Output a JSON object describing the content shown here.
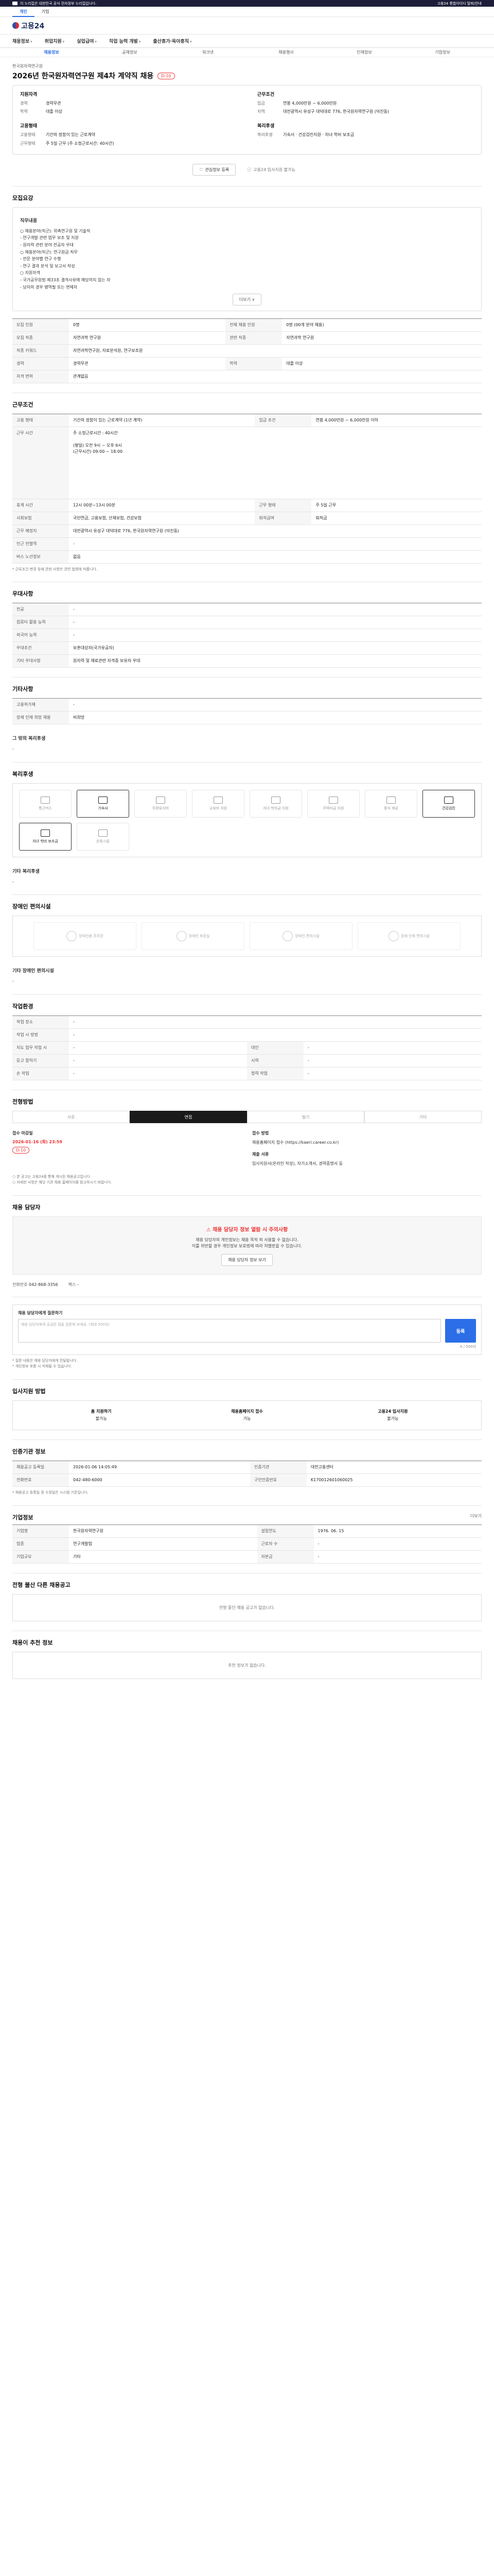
{
  "topbar": {
    "left_text": "이 누리집은 대한민국 공식 전자정부 누리집입니다.",
    "right_text": "고용24 통합아이디 탈퇴/안내"
  },
  "gtabs": [
    "개인",
    "기업"
  ],
  "logo": {
    "text": "고용24"
  },
  "gnb": [
    "채용정보",
    "취업지원",
    "실업급여",
    "직업 능력 개발",
    "출산휴가·육아휴직"
  ],
  "subnav": [
    "채용정보",
    "공채정보",
    "워크넷",
    "채용행사",
    "인재정보",
    "기업정보"
  ],
  "job": {
    "company": "한국원자력연구원",
    "title": "2026년 한국원자력연구원 제4차 계약직 채용",
    "dday": "D-10"
  },
  "summary": {
    "left_title": "지원자격",
    "left_rows": [
      {
        "k": "경력",
        "v": "경력무관"
      },
      {
        "k": "학력",
        "v": "대졸 이상"
      }
    ],
    "right_title": "근무조건",
    "right_rows": [
      {
        "k": "임금",
        "v": "연봉 4,000만원 ~ 6,000만원"
      },
      {
        "k": "지역",
        "v": "대전광역시 유성구 대덕대로 776, 한국원자력연구원 (덕진동)"
      }
    ],
    "left_title2": "고용형태",
    "left_rows2": [
      {
        "k": "고용형태",
        "v": "기간의 정함이 있는 근로계약"
      },
      {
        "k": "근무형태",
        "v": "주 5일 근무 (주 소정근로시간: 40시간)"
      }
    ],
    "right_title2": "복리후생",
    "right_rows2": [
      {
        "k": "복리후생",
        "v": "기숙사 · 건강검진지원 · 자녀 학비 보조금"
      }
    ]
  },
  "actions": {
    "save": "관심정보 등록",
    "report": "고용24 입사지원 불가능"
  },
  "recruit": {
    "title": "모집요강",
    "box_title": "직무내용",
    "body": "○ 채용분야(직군): 위촉연구원 및 기술직\n - 연구개발 관련 업무 보조 및 지원\n - 원자력 관련 분야 전공자 우대\n○ 채용분야(직군): 연구원급 직무\n - 전문 분야별 연구 수행\n - 연구 결과 분석 및 보고서 작성\n○ 지원자격\n - 국가공무원법 제33조 결격사유에 해당하지 않는 자\n - 남자의 경우 병역필 또는 면제자",
    "more_label": "더보기 ∨",
    "rows": [
      {
        "k": "모집 인원",
        "v": "0명",
        "k2": "전체 채용 인원",
        "v2": "0명 (00개 분야 채용)"
      },
      {
        "k": "모집 직종",
        "v": "자연과학 연구원",
        "k2": "관련 직종",
        "v2": "자연과학 연구원"
      },
      {
        "k": "직종 키워드",
        "v": "자연과학연구원, 자료분석원, 연구보조원",
        "k2": "",
        "v2": ""
      },
      {
        "k": "경력",
        "v": "경력무관",
        "k2": "학력",
        "v2": "대졸 이상"
      },
      {
        "k": "자격 면허",
        "v": "관계없음",
        "k2": "",
        "v2": ""
      }
    ]
  },
  "conditions": {
    "title": "근무조건",
    "rows": [
      {
        "k": "고용 형태",
        "v": "기간의 정함이 있는 근로계약 (1년 계약)",
        "k2": "임금 조건",
        "v2": "연봉 4,000만원 ~ 6,000만원 이하"
      },
      {
        "k": "근무 시간",
        "v": "주 소정근로시간 : 40시간\n\n(평일) 오전 9시 ~ 오후 6시\n(근무시간) 09:00 ~ 18:00",
        "k2": "",
        "v2": ""
      },
      {
        "k": "휴게 시간",
        "v": "12시 00분~13시 00분",
        "k2": "근무 형태",
        "v2": "주 5일 근무"
      },
      {
        "k": "사회보험",
        "v": "국민연금, 고용보험, 산재보험, 건강보험",
        "k2": "퇴직급여",
        "v2": "퇴직금"
      },
      {
        "k": "근무 예정지",
        "v": "대전광역시 유성구 대덕대로 776, 한국원자력연구원 (덕진동)",
        "k2": "",
        "v2": ""
      },
      {
        "k": "인근 전철역",
        "v": "-",
        "k2": "",
        "v2": ""
      },
      {
        "k": "버스 노선정보",
        "v": "없음",
        "k2": "",
        "v2": ""
      }
    ],
    "note": "* 근로조건 변경 등에 관한 사항은 관련 법령에 따릅니다."
  },
  "prefs": {
    "title": "우대사항",
    "rows": [
      {
        "k": "전공",
        "v": "-"
      },
      {
        "k": "컴퓨터 활용 능력",
        "v": "-"
      },
      {
        "k": "외국어 능력",
        "v": "-"
      },
      {
        "k": "우대조건",
        "v": "보훈대상자(국가유공자)"
      },
      {
        "k": "기타 우대사항",
        "v": "원자력 및 재료관련 자격증 보유자 우대"
      }
    ]
  },
  "etc": {
    "title": "기타사항",
    "rows": [
      {
        "k": "고용허가제",
        "v": "-"
      },
      {
        "k": "장애 인재 희망 채용",
        "v": "비희망"
      }
    ],
    "extra_label": "그 밖의 복리후생",
    "extra_value": "-"
  },
  "welfare": {
    "title": "복리후생",
    "tiles": [
      {
        "label": "통근버스",
        "on": false
      },
      {
        "label": "기숙사",
        "on": true
      },
      {
        "label": "차량유지비",
        "on": false
      },
      {
        "label": "교육비 지원",
        "on": false
      },
      {
        "label": "자녀 학자금 지원",
        "on": false
      },
      {
        "label": "주택자금 지원",
        "on": false
      },
      {
        "label": "중식 제공",
        "on": false
      },
      {
        "label": "건강검진",
        "on": true
      },
      {
        "label": "자녀 학비 보조금",
        "on": true
      },
      {
        "label": "운동시설",
        "on": false
      }
    ],
    "extra_label": "기타 복리후생",
    "extra_value": "-"
  },
  "disability": {
    "title": "장애인 편의시설",
    "items": [
      "장애인용 주차장",
      "장애인 화장실",
      "장애인 편의시설",
      "장애 인재 편의시설"
    ],
    "extra_label": "기타 장애인 편의시설",
    "extra_value": "-"
  },
  "workenv": {
    "title": "작업환경",
    "rows": [
      {
        "k": "작업 장소",
        "v": "-",
        "k2": "",
        "v2": ""
      },
      {
        "k": "작업 시 방법",
        "v": "-",
        "k2": "",
        "v2": ""
      },
      {
        "k": "지도 업무 작업 시",
        "v": "-",
        "k2": "대인",
        "v2": "-"
      },
      {
        "k": "듣고 말하기",
        "v": "-",
        "k2": "시력",
        "v2": "-"
      },
      {
        "k": "손 작업",
        "v": "-",
        "k2": "청력 작업",
        "v2": "-"
      }
    ]
  },
  "process": {
    "title": "전형방법",
    "steps": [
      "서류",
      "면접",
      "필기",
      "기타"
    ],
    "deadline_title": "접수 마감일",
    "deadline": "2026-01-16 (화) 23:59",
    "dday": "D-10",
    "method_title": "접수 방법",
    "method": "채용홈페이지 접수 (https://kaeri.career.co.kr)",
    "docs_title": "제출 서류",
    "docs": "입사지원서(온라인 작성), 자기소개서, 경력증명서 등",
    "notes": "○ 본 공고는 고용24를 통해 게시된 채용공고입니다.\n○ 자세한 사항은 해당 기관 채용 홈페이지를 참고하시기 바랍니다."
  },
  "contact": {
    "title": "채용 담당자",
    "caution_title": "채용 담당자 정보 열람 시 주의사항",
    "caution_body": "채용 담당자의 개인정보는 채용 목적 외 사용할 수 없습니다.\n이를 위반할 경우 개인정보 보호법에 따라 처벌받을 수 있습니다.",
    "caution_button": "채용 담당자 정보 보기",
    "phone_label": "전화번호",
    "phone": "042-868-3356",
    "fax_label": "팩스",
    "fax": "-"
  },
  "qa": {
    "title": "채용 담당자에게 질문하기",
    "placeholder": "채용 담당자에게 궁금한 점을 질문해 보세요. (최대 500자)",
    "count": "0 / 500자",
    "submit": "등록",
    "notes": "* 질문 내용은 채용 담당자에게 전달됩니다.\n* 개인정보 포함 시 삭제될 수 있습니다."
  },
  "apply": {
    "title": "입사지원 방법",
    "methods": [
      {
        "name": "홈 지원하기",
        "v": "불가능"
      },
      {
        "name": "채용홈페이지 접수",
        "v": "가능"
      },
      {
        "name": "고용24 입사지원",
        "v": "불가능"
      }
    ]
  },
  "info": {
    "title": "인증기관 정보",
    "rows": [
      {
        "k": "채용공고 등록일",
        "v": "2026-01-06 14:05:49",
        "k2": "인증기관",
        "v2": "대전고용센터"
      },
      {
        "k": "전화번호",
        "v": "042-480-6000",
        "k2": "구인인증번호",
        "v2": "K170012601060025"
      }
    ],
    "note": "* 채용공고 등록일 및 수정일은 시스템 기준입니다."
  },
  "corp": {
    "title": "기업정보",
    "more": "더보기",
    "rows": [
      {
        "k": "기업명",
        "v": "한국원자력연구원",
        "k2": "설립연도",
        "v2": "1976. 06. 15"
      },
      {
        "k": "업종",
        "v": "연구개발업",
        "k2": "근로자 수",
        "v2": "-"
      },
      {
        "k": "기업규모",
        "v": "기타",
        "k2": "자본금",
        "v2": "-"
      }
    ]
  },
  "peers": {
    "title": "전형 불산 다른 채용공고",
    "empty": "전형 중인 채용 공고가 없습니다."
  },
  "recommend": {
    "title": "채용이 추천 정보",
    "empty": "추천 정보가 없습니다."
  }
}
